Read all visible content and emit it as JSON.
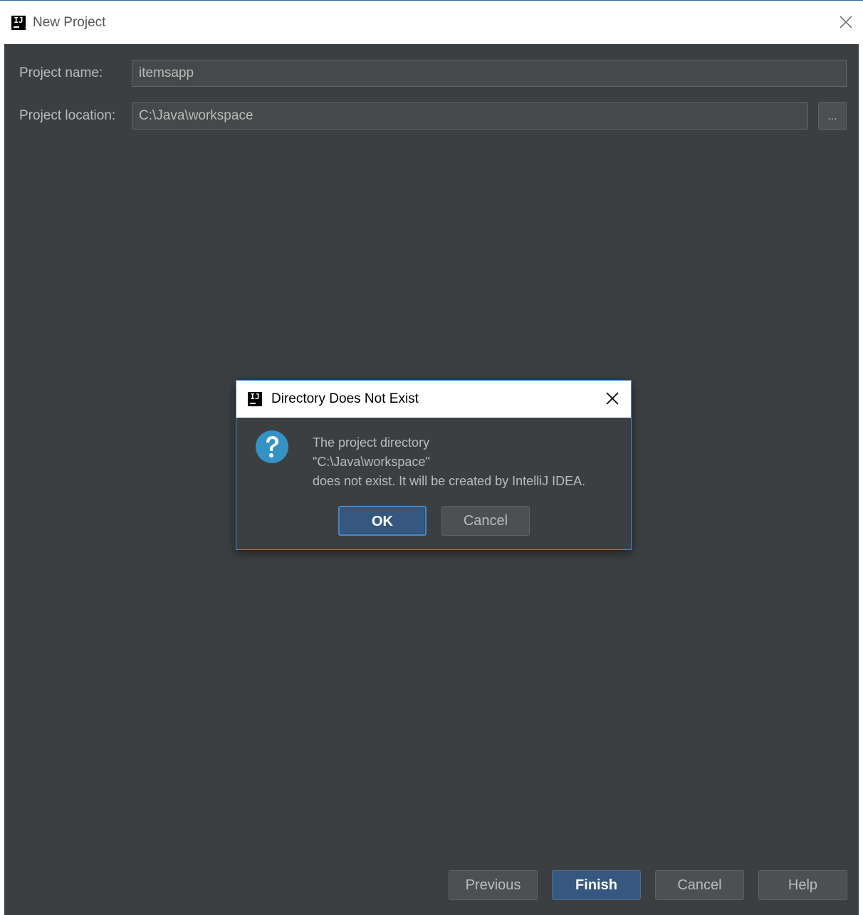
{
  "window": {
    "title": "New Project",
    "logo_text": "IJ"
  },
  "form": {
    "project_name_label": "Project name:",
    "project_name_value": "itemsapp",
    "project_location_label": "Project location:",
    "project_location_value": "C:\\Java\\workspace",
    "browse_label": "..."
  },
  "footer": {
    "previous_label": "Previous",
    "finish_label": "Finish",
    "cancel_label": "Cancel",
    "help_label": "Help"
  },
  "dialog": {
    "title": "Directory Does Not Exist",
    "logo_text": "IJ",
    "icon": "question-icon",
    "message_line1": "The project directory",
    "message_line2": "\"C:\\Java\\workspace\"",
    "message_line3": "does not exist. It will be created by IntelliJ IDEA.",
    "ok_label": "OK",
    "cancel_label": "Cancel"
  },
  "colors": {
    "background": "#3c3f41",
    "primary_button": "#365880",
    "focus_border": "#4a88c7",
    "question_icon": "#3592c4"
  }
}
